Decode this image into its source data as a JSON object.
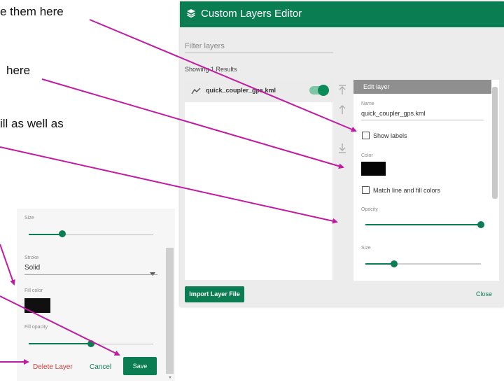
{
  "annotations": [
    "e them here",
    "here",
    "ill as well as"
  ],
  "dialog": {
    "title": "Custom Layers Editor",
    "filter_placeholder": "Filter layers",
    "results": "Showing 1 Results",
    "layer": {
      "name": "quick_coupler_gps.kml",
      "enabled": true
    },
    "edit": {
      "header": "Edit layer",
      "name_label": "Name",
      "name_value": "quick_coupler_gps.kml",
      "show_labels": "Show labels",
      "color_label": "Color",
      "color_value": "#050505",
      "match_colors": "Match line and fill colors",
      "opacity_label": "Opacity",
      "opacity_value": 1.0,
      "size_label": "Size",
      "size_value": 0.25
    },
    "import_button": "Import Layer File",
    "close_button": "Close"
  },
  "panel": {
    "size_label": "Size",
    "size_value": 0.27,
    "stroke_label": "Stroke",
    "stroke_value": "Solid",
    "fill_color_label": "Fill color",
    "fill_color_value": "#101010",
    "fill_opacity_label": "Fill opacity",
    "fill_opacity_value": 0.5,
    "delete_button": "Delete Layer",
    "cancel_button": "Cancel",
    "save_button": "Save"
  },
  "colors": {
    "accent": "#0b7d53",
    "arrow": "#c21aa0",
    "danger": "#d13b3b"
  },
  "icons": [
    "layers-icon",
    "route-icon",
    "toggle-icon",
    "move-to-top-icon",
    "move-up-icon",
    "move-down-icon",
    "dropdown-caret-icon"
  ]
}
